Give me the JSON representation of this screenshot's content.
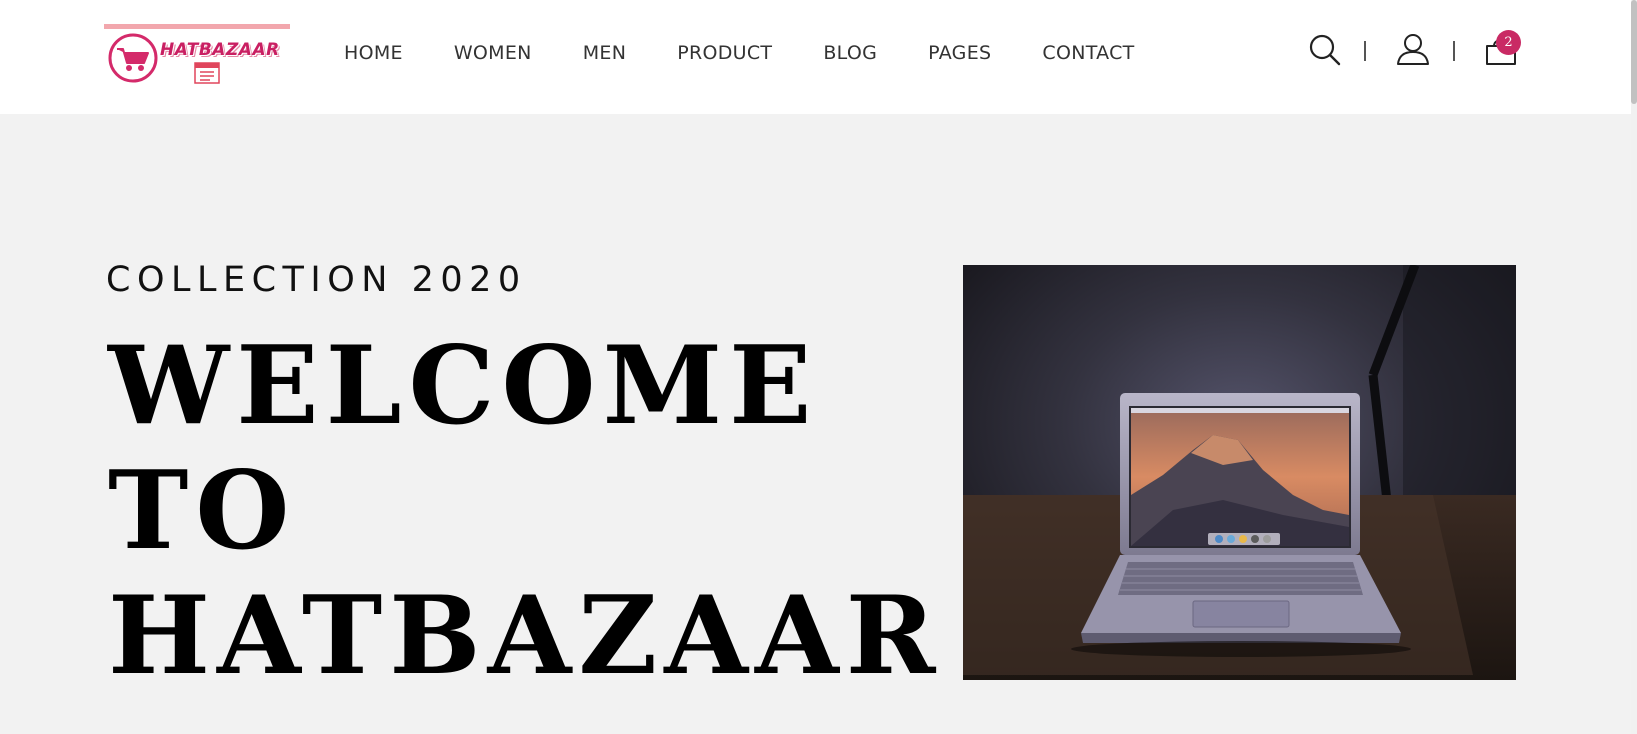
{
  "brand": {
    "name": "HATBAZAAR",
    "accent_color": "#c92a64",
    "logo_bar_color": "#f2a7ad"
  },
  "nav": {
    "items": [
      {
        "label": "HOME"
      },
      {
        "label": "WOMEN"
      },
      {
        "label": "MEN"
      },
      {
        "label": "PRODUCT"
      },
      {
        "label": "BLOG"
      },
      {
        "label": "PAGES"
      },
      {
        "label": "CONTACT"
      }
    ]
  },
  "header_icons": {
    "search": "search-icon",
    "account": "user-icon",
    "cart": "shopping-bag-icon",
    "cart_count": "2"
  },
  "hero": {
    "eyebrow": "COLLECTION 2020",
    "headline_lines": [
      "WELCOME",
      "TO",
      "HATBAZAAR"
    ],
    "image_icon": "laptop-photo"
  }
}
